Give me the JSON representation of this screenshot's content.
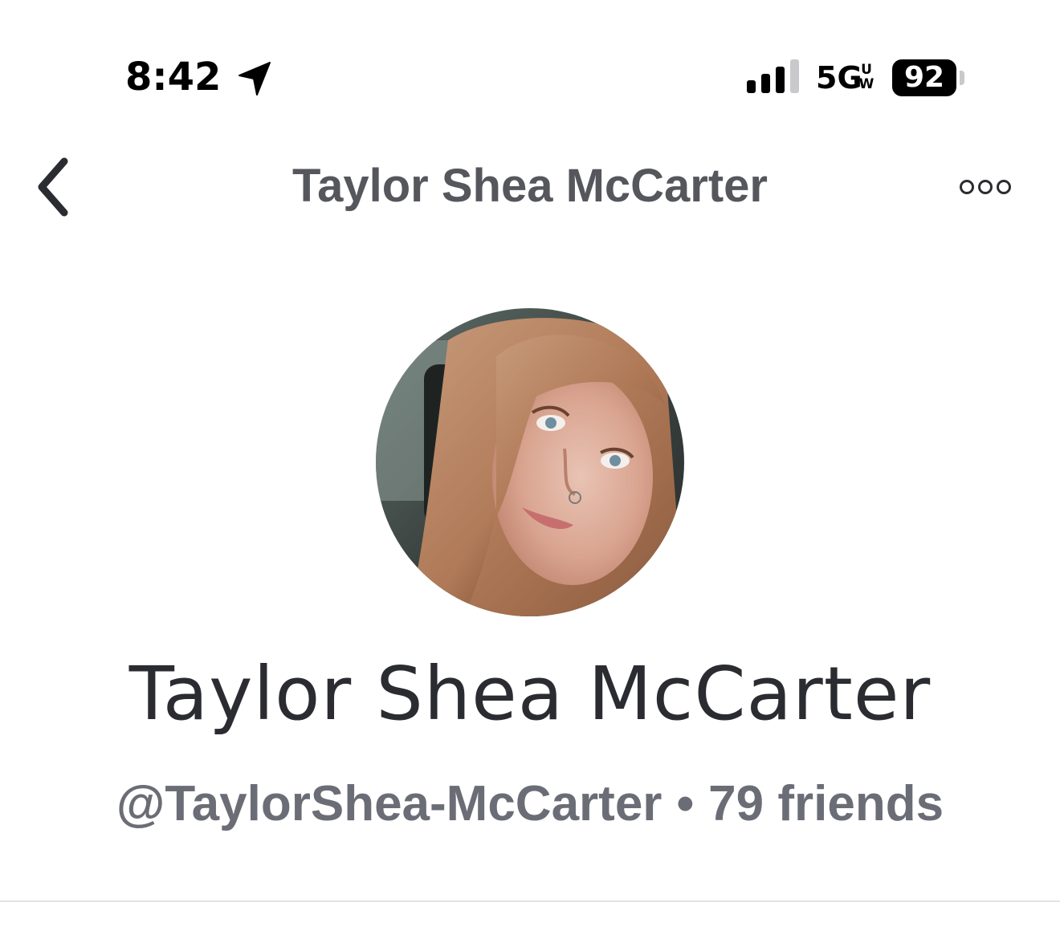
{
  "status_bar": {
    "time": "8:42",
    "network": "5G",
    "network_sup": "U\nW",
    "battery": "92"
  },
  "nav": {
    "title": "Taylor Shea McCarter",
    "back_icon": "chevron-left-icon",
    "more_icon": "more-horizontal-icon"
  },
  "profile": {
    "name": "Taylor Shea McCarter",
    "handle": "@TaylorShea-McCarter",
    "separator": "•",
    "friends": "79 friends"
  },
  "colors": {
    "nav_title": "#55575d",
    "name": "#2b2c31",
    "meta": "#6b6d76",
    "divider": "#e3e3e6"
  }
}
